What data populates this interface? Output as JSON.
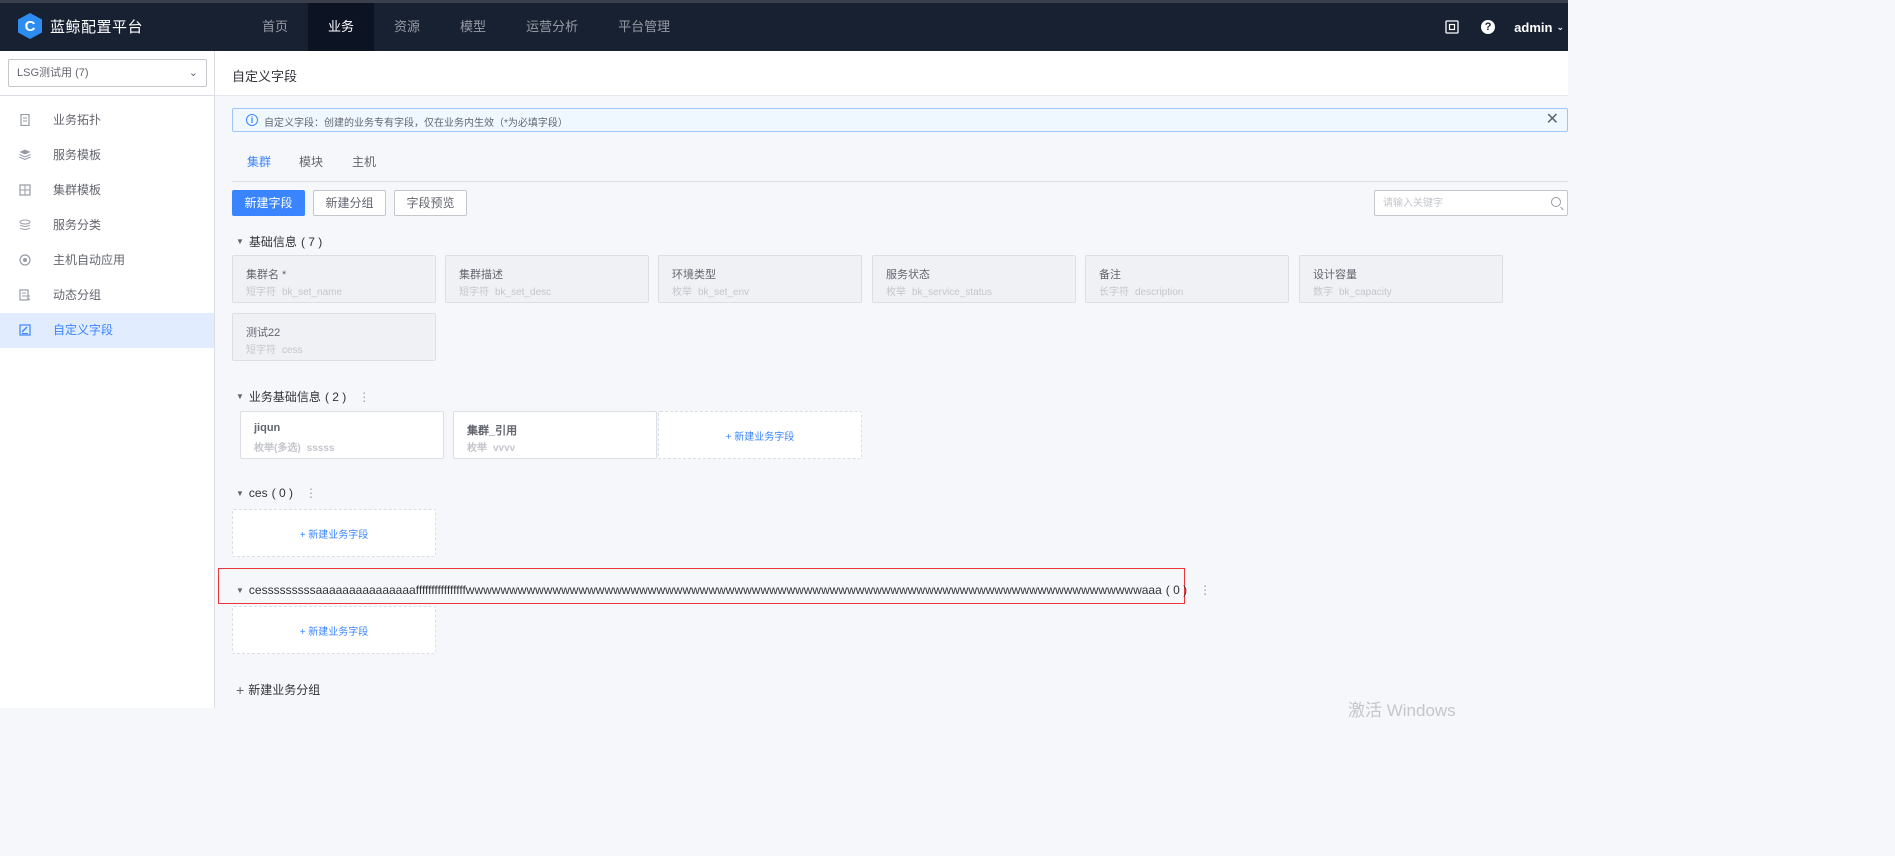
{
  "app": {
    "logo_letter": "C",
    "name": "蓝鲸配置平台"
  },
  "nav": [
    {
      "label": "首页",
      "active": false
    },
    {
      "label": "业务",
      "active": true
    },
    {
      "label": "资源",
      "active": false
    },
    {
      "label": "模型",
      "active": false
    },
    {
      "label": "运营分析",
      "active": false
    },
    {
      "label": "平台管理",
      "active": false
    }
  ],
  "topbar": {
    "help_glyph": "?",
    "user": "admin",
    "user_chevron": "⌄"
  },
  "sidebar": {
    "biz_select": {
      "value": "LSG测试用 (7)",
      "arrow": "⌄"
    },
    "items": [
      {
        "label": "业务拓扑",
        "icon": "topology-icon"
      },
      {
        "label": "服务模板",
        "icon": "service-template-icon"
      },
      {
        "label": "集群模板",
        "icon": "cluster-template-icon"
      },
      {
        "label": "服务分类",
        "icon": "service-category-icon"
      },
      {
        "label": "主机自动应用",
        "icon": "host-auto-apply-icon"
      },
      {
        "label": "动态分组",
        "icon": "dynamic-group-icon"
      },
      {
        "label": "自定义字段",
        "icon": "custom-field-icon",
        "active": true
      }
    ]
  },
  "header": {
    "title": "自定义字段"
  },
  "alert": {
    "info_glyph": "i",
    "text": "自定义字段：创建的业务专有字段，仅在业务内生效（*为必填字段）",
    "close_glyph": "✕"
  },
  "tabs": [
    {
      "label": "集群",
      "active": true
    },
    {
      "label": "模块",
      "active": false
    },
    {
      "label": "主机",
      "active": false
    }
  ],
  "toolbar": {
    "new_field": "新建字段",
    "new_group": "新建分组",
    "preview": "字段预览",
    "search_placeholder": "请输入关键字"
  },
  "groups": [
    {
      "name": "基础信息",
      "count": "( 7 )",
      "has_more": false,
      "fields": [
        {
          "name": "集群名 *",
          "type": "短字符",
          "id": "bk_set_name"
        },
        {
          "name": "集群描述",
          "type": "短字符",
          "id": "bk_set_desc"
        },
        {
          "name": "环境类型",
          "type": "枚举",
          "id": "bk_set_env"
        },
        {
          "name": "服务状态",
          "type": "枚举",
          "id": "bk_service_status"
        },
        {
          "name": "备注",
          "type": "长字符",
          "id": "description"
        },
        {
          "name": "设计容量",
          "type": "数字",
          "id": "bk_capacity"
        },
        {
          "name": "测试22",
          "type": "短字符",
          "id": "cess"
        }
      ]
    },
    {
      "name": "业务基础信息",
      "count": "( 2 )",
      "has_more": true,
      "fields": [
        {
          "name": "jiqun",
          "type": "枚举(多选)",
          "id": "sssss"
        },
        {
          "name": "集群_引用",
          "type": "枚举",
          "id": "vvvv"
        }
      ]
    },
    {
      "name": "ces",
      "count": "( 0 )",
      "has_more": true,
      "fields": []
    },
    {
      "name": "cesssssssssaaaaaaaaaaaaaaaffffffffffffffffwwwwwwwwwwwwwwwwwwwwwwwwwwwwwwwwwwwwwwwwwwwwwwwwwwwwwwwwwwwwwwwwwwwwwwwwwwwwwwaaa",
      "count": "( 0 )",
      "has_more": true,
      "fields": []
    }
  ],
  "add_field_label": "+ 新建业务字段",
  "new_group_link": "新建业务分组",
  "more_glyph": "⋮",
  "collapse_glyph": "▼",
  "watermark": "激活 Windows"
}
